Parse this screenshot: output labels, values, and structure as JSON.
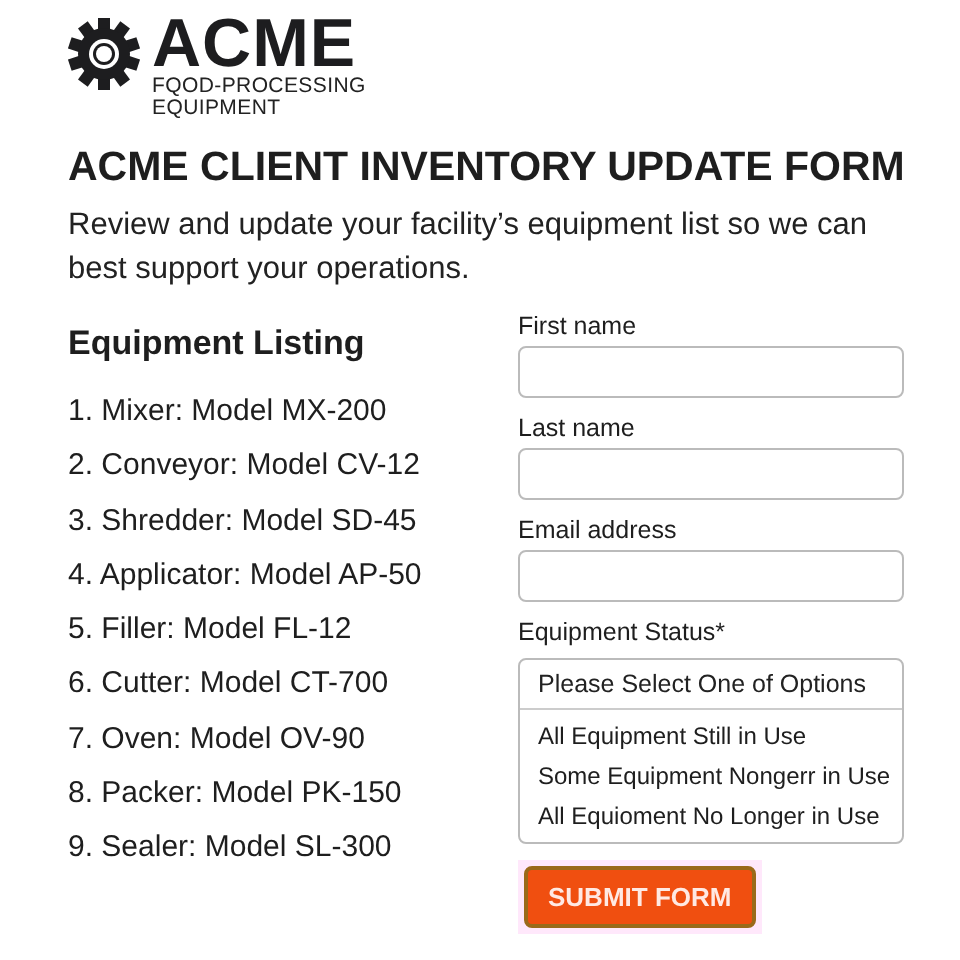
{
  "logo": {
    "name": "ACME",
    "tagline_1": "FQOD-PROCESSING",
    "tagline_2": "EQUIPMENT"
  },
  "title": "ACME CLIENT INVENTORY UPDATE FORM",
  "intro": "Review and update your facility’s equipment list so we can best support your operations.",
  "equipment": {
    "heading": "Equipment Listing",
    "items": [
      "1. Mixer: Model MX-200",
      "2. Conveyor: Model CV-12",
      "3. Shredder: Model SD-45",
      "4. Applicator: Model AP-50",
      "5. Filler: Model FL-12",
      "6. Cutter: Model CT-700",
      "7. Oven: Model OV-90",
      "8. Packer: Model PK-150",
      "9. Sealer: Model SL-300"
    ]
  },
  "form": {
    "fields": [
      {
        "label": "First name"
      },
      {
        "label": "Last name"
      },
      {
        "label": "Email address"
      }
    ],
    "status": {
      "label": "Equipment Status*",
      "placeholder": "Please Select One of Options",
      "options": [
        "All Equipment Still in Use",
        "Some Equipment Nongerr in Use",
        "All Equioment No Longer in Use"
      ]
    },
    "submit": "SUBMIT FORM"
  }
}
